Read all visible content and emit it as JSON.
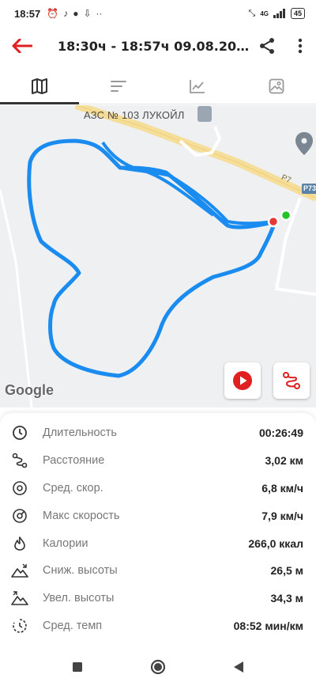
{
  "status_bar": {
    "time": "18:57",
    "network": "4G",
    "battery": "45"
  },
  "header": {
    "title": "18:30ч - 18:57ч   09.08.20..."
  },
  "tabs": [
    {
      "icon": "map-icon",
      "active": true
    },
    {
      "icon": "list-icon",
      "active": false
    },
    {
      "icon": "chart-icon",
      "active": false
    },
    {
      "icon": "photo-icon",
      "active": false
    }
  ],
  "map": {
    "poi_label": "АЗС № 103 ЛУКОЙЛ",
    "road_label_1": "Р7",
    "road_shield": "Р73",
    "attribution": "Google",
    "track_color": "#1a8cf0",
    "start_color": "#22c326",
    "end_color": "#e53935"
  },
  "stats": [
    {
      "icon": "timer-icon",
      "label": "Длительность",
      "value": "00:26:49"
    },
    {
      "icon": "route-icon",
      "label": "Расстояние",
      "value": "3,02 км"
    },
    {
      "icon": "speed-avg-icon",
      "label": "Сред. скор.",
      "value": "6,8 км/ч"
    },
    {
      "icon": "speed-max-icon",
      "label": "Макс скорость",
      "value": "7,9 км/ч"
    },
    {
      "icon": "flame-icon",
      "label": "Калории",
      "value": "266,0 ккал"
    },
    {
      "icon": "descent-icon",
      "label": "Сниж. высоты",
      "value": "26,5 м"
    },
    {
      "icon": "ascent-icon",
      "label": "Увел. высоты",
      "value": "34,3 м"
    },
    {
      "icon": "pace-icon",
      "label": "Сред. темп",
      "value": "08:52 мин/км"
    }
  ]
}
